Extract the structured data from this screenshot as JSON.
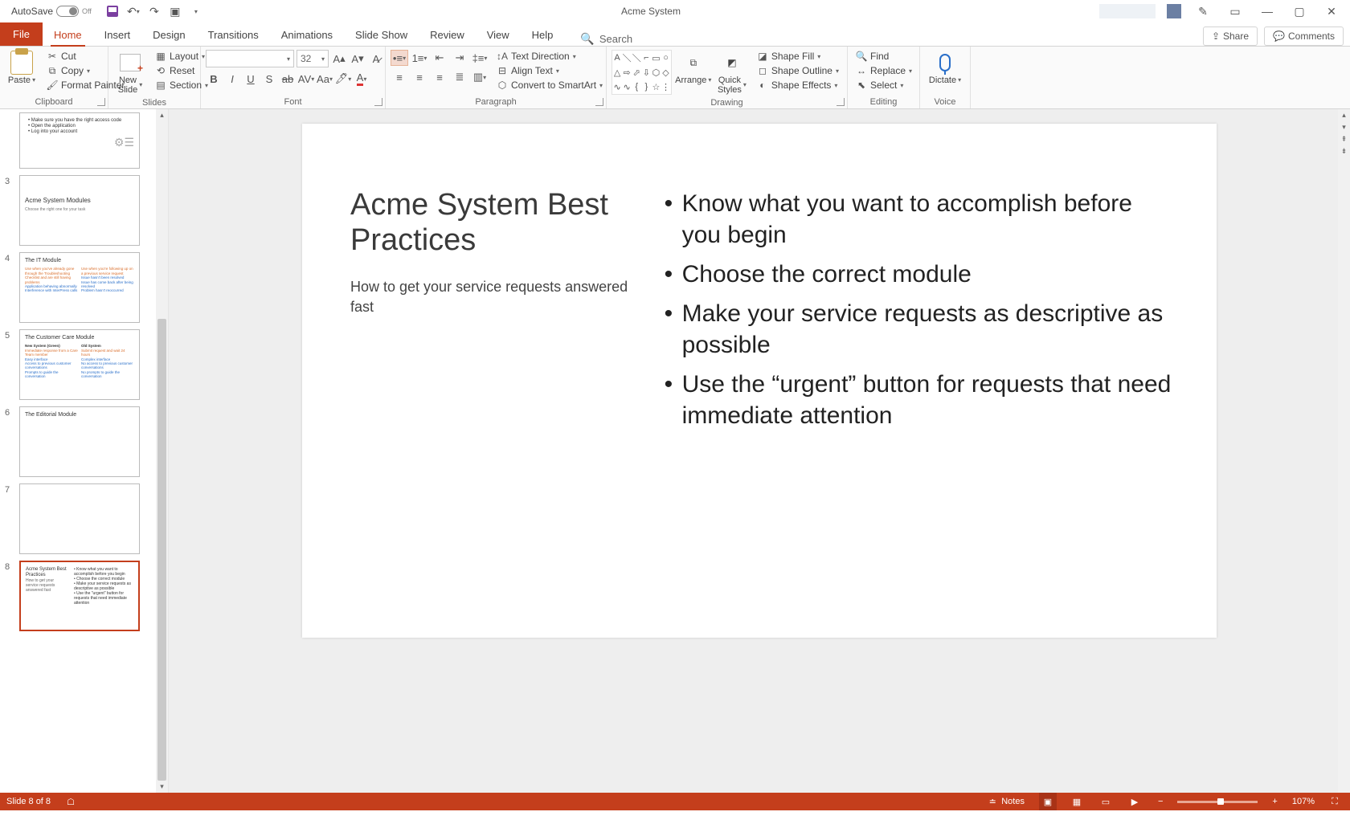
{
  "titlebar": {
    "autosave_label": "AutoSave",
    "autosave_state": "Off",
    "document_title": "Acme System"
  },
  "window_controls": {
    "minimize": "—",
    "maximize": "▢",
    "close": "✕"
  },
  "tabs": {
    "file": "File",
    "home": "Home",
    "insert": "Insert",
    "design": "Design",
    "transitions": "Transitions",
    "animations": "Animations",
    "slideshow": "Slide Show",
    "review": "Review",
    "view": "View",
    "help": "Help",
    "search_placeholder": "Search",
    "share": "Share",
    "comments": "Comments"
  },
  "ribbon": {
    "clipboard": {
      "label": "Clipboard",
      "paste": "Paste",
      "cut": "Cut",
      "copy": "Copy",
      "format_painter": "Format Painter"
    },
    "slides": {
      "label": "Slides",
      "new_slide": "New\nSlide",
      "layout": "Layout",
      "reset": "Reset",
      "section": "Section"
    },
    "font": {
      "label": "Font",
      "size": "32"
    },
    "paragraph": {
      "label": "Paragraph",
      "text_direction": "Text Direction",
      "align_text": "Align Text",
      "smartart": "Convert to SmartArt"
    },
    "drawing": {
      "label": "Drawing",
      "arrange": "Arrange",
      "quick_styles": "Quick\nStyles",
      "shape_fill": "Shape Fill",
      "shape_outline": "Shape Outline",
      "shape_effects": "Shape Effects"
    },
    "editing": {
      "label": "Editing",
      "find": "Find",
      "replace": "Replace",
      "select": "Select"
    },
    "voice": {
      "label": "Voice",
      "dictate": "Dictate"
    }
  },
  "thumbnails": [
    {
      "num": "",
      "title": "",
      "lines": [
        "Make sure you have the right access code",
        "Open the application",
        "Log into your account"
      ]
    },
    {
      "num": "3",
      "title": "Acme System Modules",
      "lines": [
        "Choose the right one for your task"
      ]
    },
    {
      "num": "4",
      "title": "The IT Module",
      "left_heading": "Use when you've already gone through the Troubleshooting Checklist and are still having problems",
      "left_items": [
        "Application behaving abnormally",
        "Interference with InterPress calls"
      ],
      "right_heading": "Use when you're following up on a previous service request",
      "right_items": [
        "Issue hasn't been resolved",
        "Issue has come back after being resolved",
        "Problem hasn't reoccurred"
      ]
    },
    {
      "num": "5",
      "title": "The Customer Care Module",
      "col1_h": "New System (Green)",
      "col1": [
        "Immediate response from a Care Team member",
        "Easy interface",
        "Access to previous customer conversations",
        "Prompts to guide the conversation"
      ],
      "col2_h": "Old System",
      "col2": [
        "Submit request and wait 24 hours",
        "Complex interface",
        "No access to previous customer conversations",
        "No prompts to guide the conversation"
      ]
    },
    {
      "num": "6",
      "title": "The Editorial Module",
      "lines": []
    },
    {
      "num": "7",
      "title": "",
      "lines": []
    },
    {
      "num": "8",
      "title": "Acme System Best Practices",
      "sub": "How to get your service requests answered fast",
      "bullets": [
        "Know what you want to accomplish before you begin",
        "Choose the correct module",
        "Make your service requests as descriptive as possible",
        "Use the \"urgent\" button for requests that need immediate attention"
      ]
    }
  ],
  "current_slide": {
    "title": "Acme System Best Practices",
    "subtitle": "How to get your service requests answered fast",
    "bullets": [
      "Know what you want to accomplish before you begin",
      "Choose the correct module",
      "Make your service requests as descriptive as possible",
      "Use the “urgent” button for requests that need immediate attention"
    ]
  },
  "statusbar": {
    "slide_counter": "Slide 8 of 8",
    "notes": "Notes",
    "zoom_pct": "107%"
  }
}
